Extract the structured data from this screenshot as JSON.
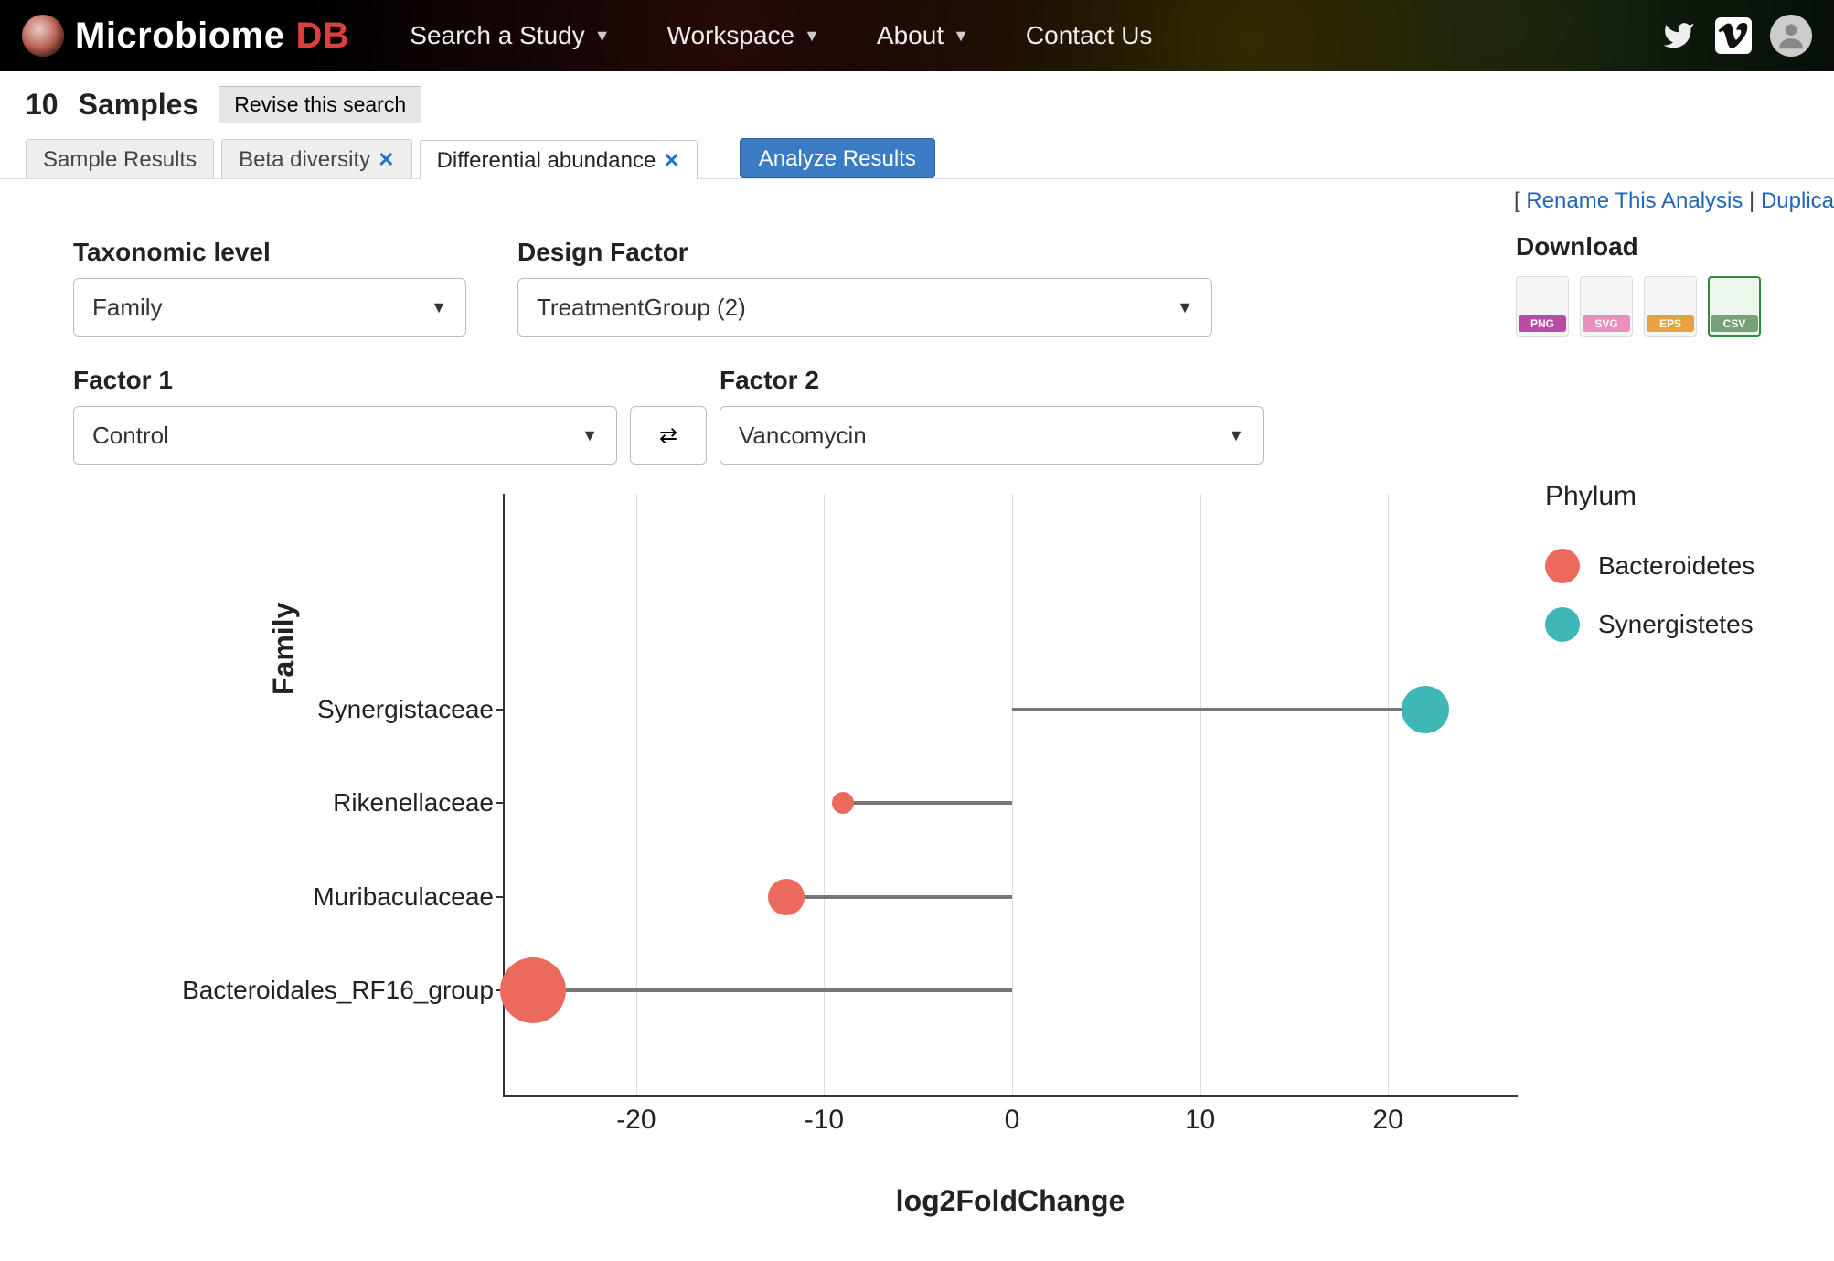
{
  "header": {
    "brand_a": "Microbiome",
    "brand_b": "DB",
    "nav": [
      {
        "label": "Search a Study",
        "caret": true
      },
      {
        "label": "Workspace",
        "caret": true
      },
      {
        "label": "About",
        "caret": true
      },
      {
        "label": "Contact Us",
        "caret": false
      }
    ]
  },
  "summary": {
    "count": "10",
    "label": "Samples",
    "revise": "Revise this search"
  },
  "tabs": {
    "sample_results": "Sample Results",
    "beta_diversity": "Beta diversity",
    "diff_abund": "Differential abundance",
    "analyze": "Analyze Results"
  },
  "analysis_links": {
    "open": "[",
    "rename": "Rename This Analysis",
    "sep": " | ",
    "dup": "Duplica"
  },
  "controls": {
    "taxonomic_label": "Taxonomic level",
    "taxonomic_value": "Family",
    "design_label": "Design Factor",
    "design_value": "TreatmentGroup (2)",
    "factor1_label": "Factor 1",
    "factor1_value": "Control",
    "factor2_label": "Factor 2",
    "factor2_value": "Vancomycin",
    "download_label": "Download"
  },
  "chart_data": {
    "type": "lollipop",
    "xlabel": "log2FoldChange",
    "ylabel": "Family",
    "xlim": [
      -27,
      27
    ],
    "x_ticks": [
      -20,
      -10,
      0,
      10,
      20
    ],
    "legend_title": "Phylum",
    "legend": [
      {
        "name": "Bacteroidetes",
        "color": "#ec6a5d"
      },
      {
        "name": "Synergistetes",
        "color": "#3fb7b7"
      }
    ],
    "series": [
      {
        "family": "Synergistaceae",
        "value": 22,
        "phylum": "Synergistetes",
        "size": 52
      },
      {
        "family": "Rikenellaceae",
        "value": -9,
        "phylum": "Bacteroidetes",
        "size": 24
      },
      {
        "family": "Muribaculaceae",
        "value": -12,
        "phylum": "Bacteroidetes",
        "size": 40
      },
      {
        "family": "Bacteroidales_RF16_group",
        "value": -25.5,
        "phylum": "Bacteroidetes",
        "size": 72
      }
    ]
  }
}
